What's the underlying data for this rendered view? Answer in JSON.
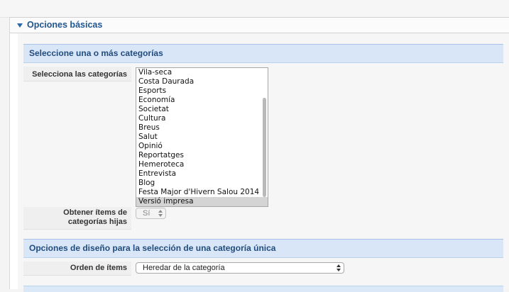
{
  "panel": {
    "title": "Opciones básicas"
  },
  "section1": {
    "title": "Seleccione una o más categorías",
    "categories_label": "Selecciona las categorías",
    "categories": [
      "Vila-seca",
      "Costa Daurada",
      "Esports",
      "Economía",
      "Societat",
      "Cultura",
      "Breus",
      "Salut",
      "Opinió",
      "Reportatges",
      "Hemeroteca",
      "Entrevista",
      "Blog",
      "Festa Major d'Hivern Salou 2014",
      "Versió impresa"
    ],
    "selected_category": "Versió impresa",
    "child_items_label": "Obtener ítems de categorías hijas",
    "child_items_value": "Sí"
  },
  "section2": {
    "title": "Opciones de diseño para la selección de una categoría única",
    "order_label": "Orden de ítems",
    "order_value": "Heredar de la categoría"
  }
}
